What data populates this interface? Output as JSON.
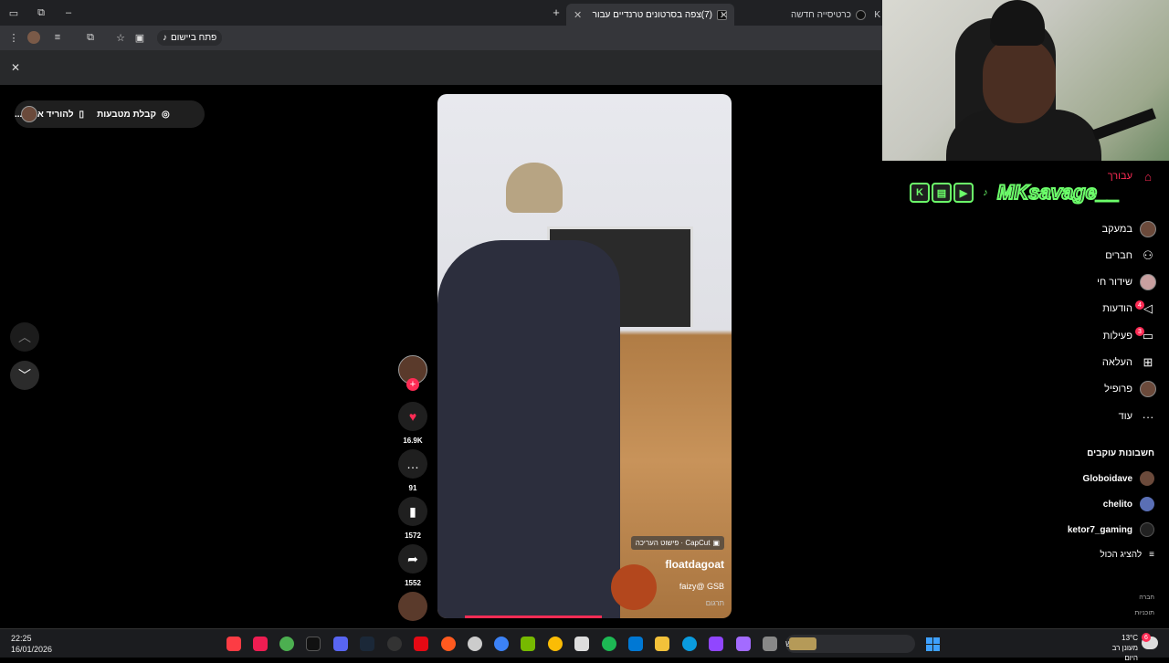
{
  "browser": {
    "tabs": [
      {
        "label": "(7)צפה בסרטונים טרנדיים עבור",
        "active": true
      },
      {
        "label": "כרטיסייה חדשה",
        "active": false
      },
      {
        "label": "K",
        "active": false
      }
    ],
    "new_tab": "+",
    "open_in_app": "פתח ביישום",
    "close_infobar": "✕"
  },
  "page": {
    "download_pill": {
      "get_coins": "קבלת מטבעות",
      "download_app": "להוריד את ה..."
    }
  },
  "stream_overlay": {
    "channel_name": "MKsavage__"
  },
  "video": {
    "capcut_label": "CapCut · פישוט העריכה",
    "username": "floatdagoat",
    "description": "faizy@ GSB",
    "translate": "תרגום"
  },
  "actions": {
    "likes": "16.9K",
    "comments": "91",
    "saves": "1572",
    "shares": "1552"
  },
  "sidebar": {
    "items": [
      {
        "label": "עבורך",
        "icon": "home-icon"
      },
      {
        "label": "במעקב",
        "icon": "avatar"
      },
      {
        "label": "חברים",
        "icon": "friends-icon"
      },
      {
        "label": "שידור חי",
        "icon": "live-icon"
      },
      {
        "label": "הודעות",
        "icon": "send-icon",
        "badge": "4"
      },
      {
        "label": "פעילות",
        "icon": "activity-icon",
        "badge": "3"
      },
      {
        "label": "העלאה",
        "icon": "upload-icon"
      },
      {
        "label": "פרופיל",
        "icon": "avatar"
      },
      {
        "label": "עוד",
        "icon": "more-icon"
      }
    ],
    "following_title": "חשבונות עוקבים",
    "following": [
      "Globoidave",
      "chelito",
      "ketor7_gaming"
    ],
    "show_all": "להציג הכול",
    "footer": [
      "חברה",
      "תוכניות"
    ]
  },
  "taskbar": {
    "time": "22:25",
    "date": "16/01/2026",
    "search_placeholder": "חפש",
    "weather_temp": "13°C",
    "weather_desc": "מעונן רב היום",
    "notif_count": "6",
    "accent": "#3ea0ff"
  }
}
